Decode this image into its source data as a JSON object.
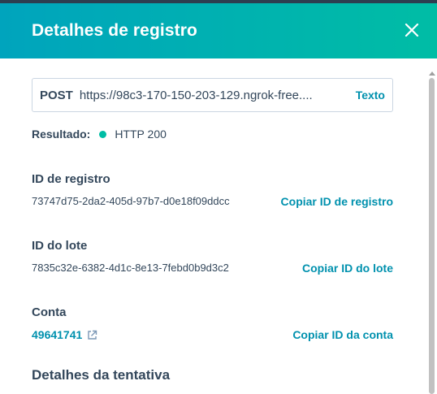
{
  "panel": {
    "title": "Detalhes de registro"
  },
  "request": {
    "method": "POST",
    "url": "https://98c3-170-150-203-129.ngrok-free....",
    "format_link": "Texto"
  },
  "result": {
    "label": "Resultado:",
    "status": "HTTP 200",
    "status_color": "#00bda5"
  },
  "log_id": {
    "label": "ID de registro",
    "value": "73747d75-2da2-405d-97b7-d0e18f09ddcc",
    "copy_label": "Copiar ID de registro"
  },
  "batch_id": {
    "label": "ID do lote",
    "value": "7835c32e-6382-4d1c-8e13-7febd0b9d3c2",
    "copy_label": "Copiar ID do lote"
  },
  "account": {
    "label": "Conta",
    "value": "49641741",
    "copy_label": "Copiar ID da conta"
  },
  "attempt": {
    "heading": "Detalhes da tentativa"
  },
  "icons": {
    "close": "close-icon",
    "external_link": "external-link-icon"
  },
  "colors": {
    "header_start": "#00a4bd",
    "header_end": "#00bda5",
    "link": "#0091ae",
    "text": "#33475b"
  }
}
